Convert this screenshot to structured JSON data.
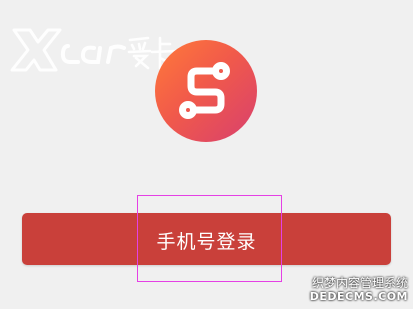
{
  "watermark_top": {
    "text": "Xcar爱卡",
    "color": "#ffffff"
  },
  "app_logo": {
    "icon": "route-path-icon",
    "gradient_start": "#ff7a3a",
    "gradient_end": "#d8406e"
  },
  "login": {
    "label": "手机号登录",
    "background": "#c9403a"
  },
  "watermark_bottom": {
    "line1": "织梦内容管理系统",
    "line2": "DEDECMS.COM"
  }
}
